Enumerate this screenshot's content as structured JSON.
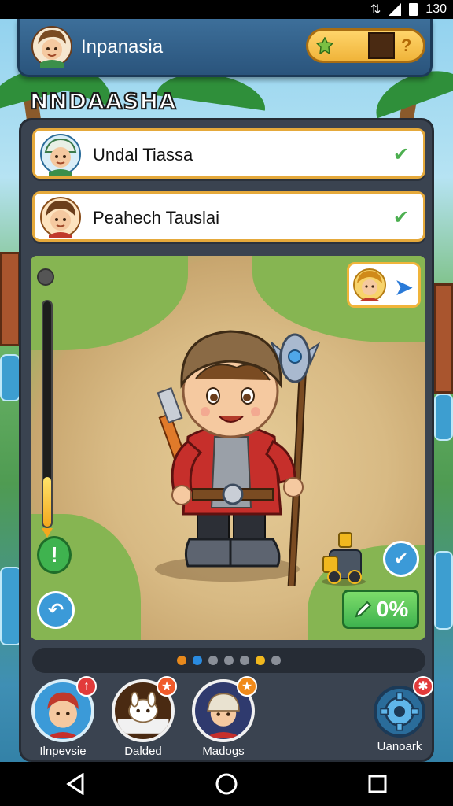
{
  "status_bar": {
    "time": "130",
    "icons": [
      "data-icon",
      "signal-icon",
      "battery-icon"
    ]
  },
  "header": {
    "player_name": "Inpanasia",
    "currency_help": "?"
  },
  "main_title": "NNDAASHA",
  "tasks": [
    {
      "name": "Undal Tiassa",
      "status_icon": "check-icon"
    },
    {
      "name": "Peahech Tauslai",
      "status_icon": "check-icon"
    }
  ],
  "game_view": {
    "progress_percent": "0%",
    "vertical_meter_level": 0.22,
    "excl_label": "!",
    "next_arrow": "➤"
  },
  "pager": {
    "dots": [
      "#e8891c",
      "#2a8be0",
      "#8a8f98",
      "#8a8f98",
      "#8a8f98",
      "#f1b81e",
      "#8a8f98"
    ]
  },
  "bottom_nav": [
    {
      "label": "Ilnpevsie",
      "badge": "↑",
      "badge_color": "#e23b3b"
    },
    {
      "label": "Dalded",
      "badge": "★",
      "badge_color": "#f05a2a"
    },
    {
      "label": "Madogs",
      "badge": "★",
      "badge_color": "#f08a1a"
    },
    {
      "label": "Uanoark",
      "badge": "✱",
      "badge_color": "#e23b3b"
    }
  ],
  "colors": {
    "accent": "#f0b43a",
    "panel": "#3a4350",
    "header": "#2a547c",
    "success": "#3fb34f",
    "info": "#3b9ad8"
  }
}
